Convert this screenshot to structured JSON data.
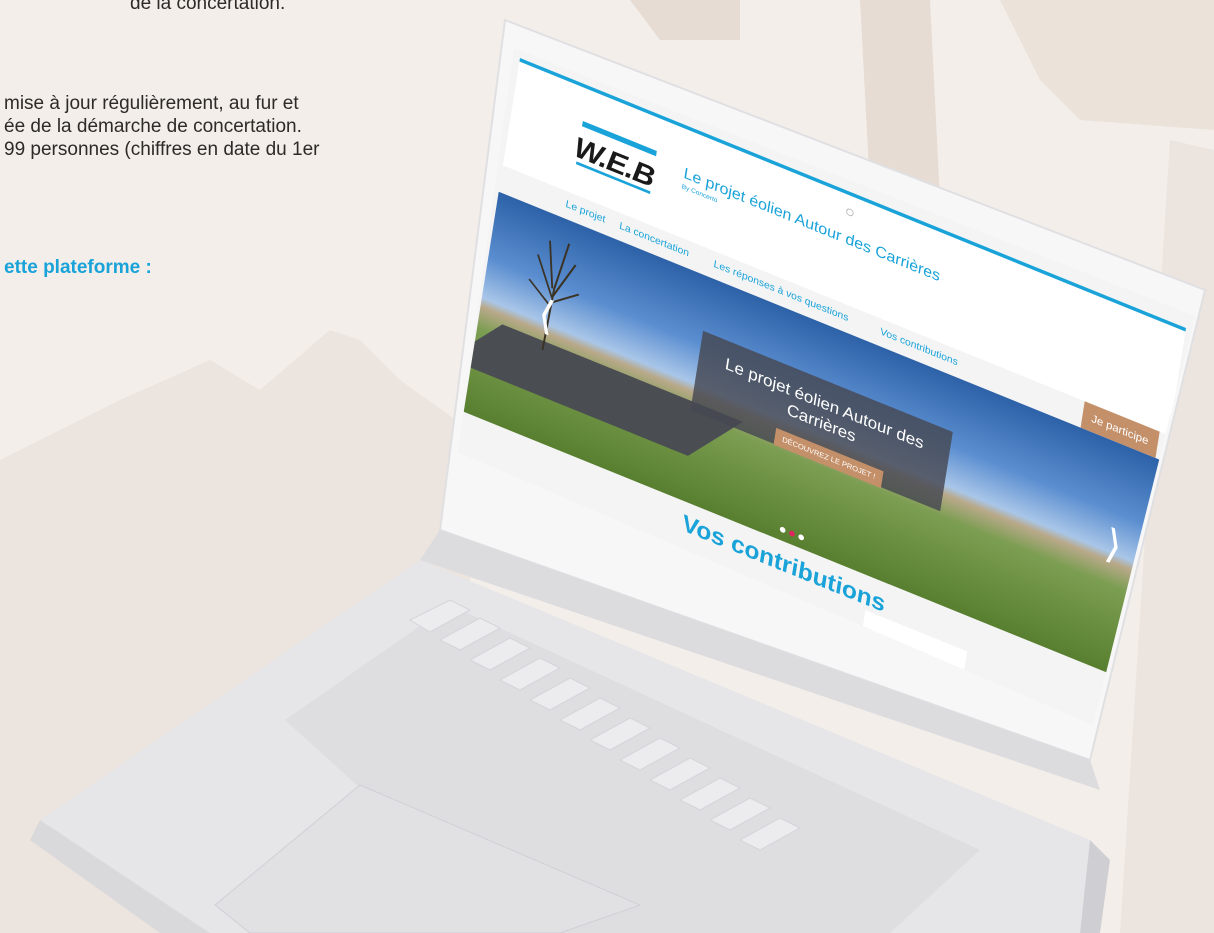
{
  "colors": {
    "accent": "#1aa3d9",
    "cta": "#c4906a",
    "dot_active": "#e0245e",
    "background": "#f3eeea"
  },
  "left_text": {
    "line1": "de la concertation.",
    "line2": "mise à jour régulièrement, au fur et",
    "line3": "ée de la démarche de concertation.",
    "line4": "99 personnes (chiffres en date du 1er",
    "line5": "ette plateforme :"
  },
  "site": {
    "logo_text": "W.E.B",
    "title": "Le projet éolien Autour des Carrières",
    "subtitle": "By Concerto",
    "nav": [
      {
        "label": "Le projet"
      },
      {
        "label": "La concertation"
      },
      {
        "label": "Les réponses à vos questions"
      },
      {
        "label": "Vos contributions"
      }
    ],
    "cta_label": "Je participe",
    "hero": {
      "title": "Le projet éolien Autour des Carrières",
      "button": "DÉCOUVREZ LE PROJET !",
      "prev_icon": "chevron-left-icon",
      "next_icon": "chevron-right-icon",
      "slide_count": 3,
      "active_slide": 2
    },
    "section_title": "Vos contributions"
  }
}
